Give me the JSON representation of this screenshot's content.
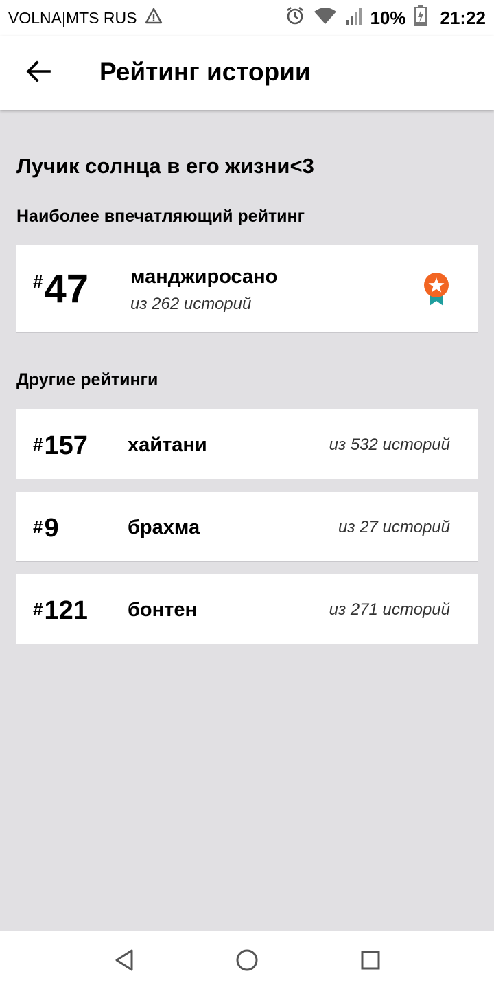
{
  "status_bar": {
    "carrier": "VOLNA|MTS RUS",
    "battery_percent": "10%",
    "time": "21:22",
    "icons": [
      "warning-icon",
      "alarm-icon",
      "wifi-icon",
      "signal-icon",
      "battery-charging-icon"
    ]
  },
  "app_bar": {
    "title": "Рейтинг истории",
    "back_icon": "arrow-left-icon"
  },
  "story": {
    "title": "Лучик солнца в его жизни<3"
  },
  "main_ranking": {
    "section_label": "Наиболее впечатляющий рейтинг",
    "hash": "#",
    "rank": "47",
    "tag": "манджиросано",
    "count": "из 262 историй",
    "icon": "medal-star-icon",
    "medal_color": "#f26522",
    "ribbon_color": "#1f9e9e"
  },
  "other_rankings": {
    "section_label": "Другие рейтинги",
    "items": [
      {
        "hash": "#",
        "rank": "157",
        "tag": "хайтани",
        "count": "из 532 историй"
      },
      {
        "hash": "#",
        "rank": "9",
        "tag": "брахма",
        "count": "из 27 историй"
      },
      {
        "hash": "#",
        "rank": "121",
        "tag": "бонтен",
        "count": "из 271 историй"
      }
    ]
  },
  "nav_bar": {
    "icons": [
      "nav-back-triangle-icon",
      "nav-home-circle-icon",
      "nav-recents-square-icon"
    ]
  }
}
